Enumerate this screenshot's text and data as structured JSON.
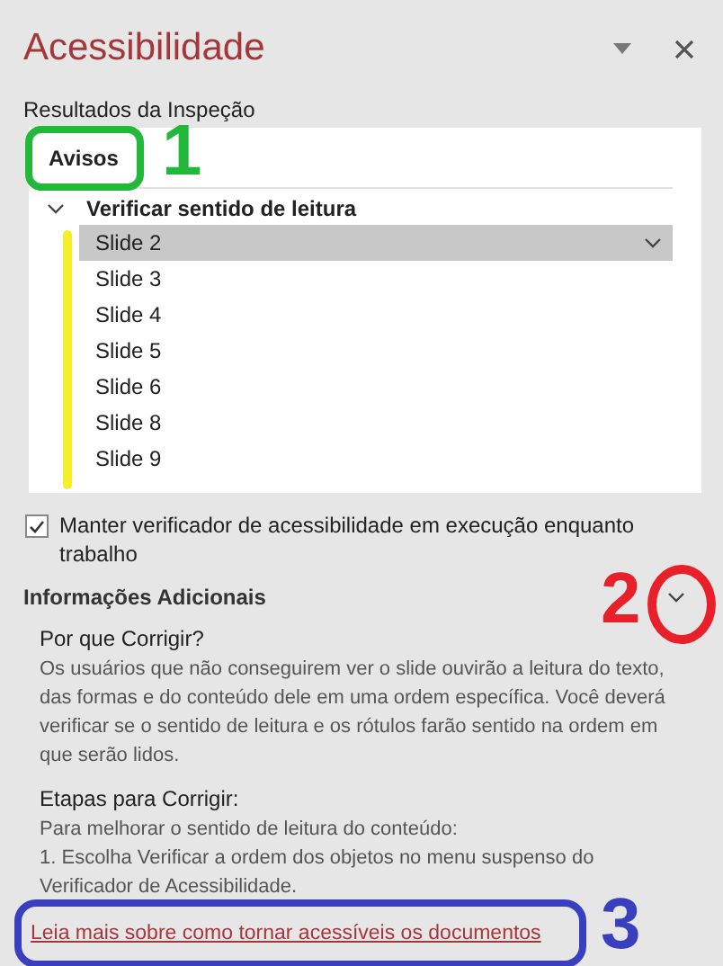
{
  "pane": {
    "title": "Acessibilidade"
  },
  "results": {
    "label": "Resultados da Inspeção",
    "tab": "Avisos",
    "groups": [
      {
        "label": "Verificar sentido de leitura",
        "expanded": true,
        "items": [
          {
            "label": "Slide 2",
            "selected": true
          },
          {
            "label": "Slide 3",
            "selected": false
          },
          {
            "label": "Slide 4",
            "selected": false
          },
          {
            "label": "Slide 5",
            "selected": false
          },
          {
            "label": "Slide 6",
            "selected": false
          },
          {
            "label": "Slide 8",
            "selected": false
          },
          {
            "label": "Slide 9",
            "selected": false
          }
        ]
      }
    ]
  },
  "keep_running": {
    "label": "Manter verificador de acessibilidade em execução enquanto trabalho",
    "checked": true
  },
  "info": {
    "heading": "Informações Adicionais",
    "expanded": true,
    "sections": [
      {
        "title": "Por que Corrigir?",
        "lines": [
          "Os usuários que não conseguirem ver o slide ouvirão a leitura do texto, das formas e do conteúdo dele em uma ordem específica. Você deverá verificar se o sentido de leitura e os rótulos farão sentido na ordem em que serão lidos."
        ]
      },
      {
        "title": "Etapas para Corrigir:",
        "lines": [
          "Para melhorar o sentido de leitura do conteúdo:",
          "1. Escolha Verificar a ordem dos objetos no menu suspenso do Verificador de Acessibilidade."
        ]
      }
    ]
  },
  "link": "Leia mais sobre como tornar acessíveis os documentos",
  "annotations": [
    {
      "kind": "tab",
      "number": "1",
      "color": "#22b83a"
    },
    {
      "kind": "list",
      "color": "#f5ef2a"
    },
    {
      "kind": "chevron",
      "number": "2",
      "color": "#e8202a"
    },
    {
      "kind": "link",
      "number": "3",
      "color": "#3a3fc0"
    }
  ]
}
